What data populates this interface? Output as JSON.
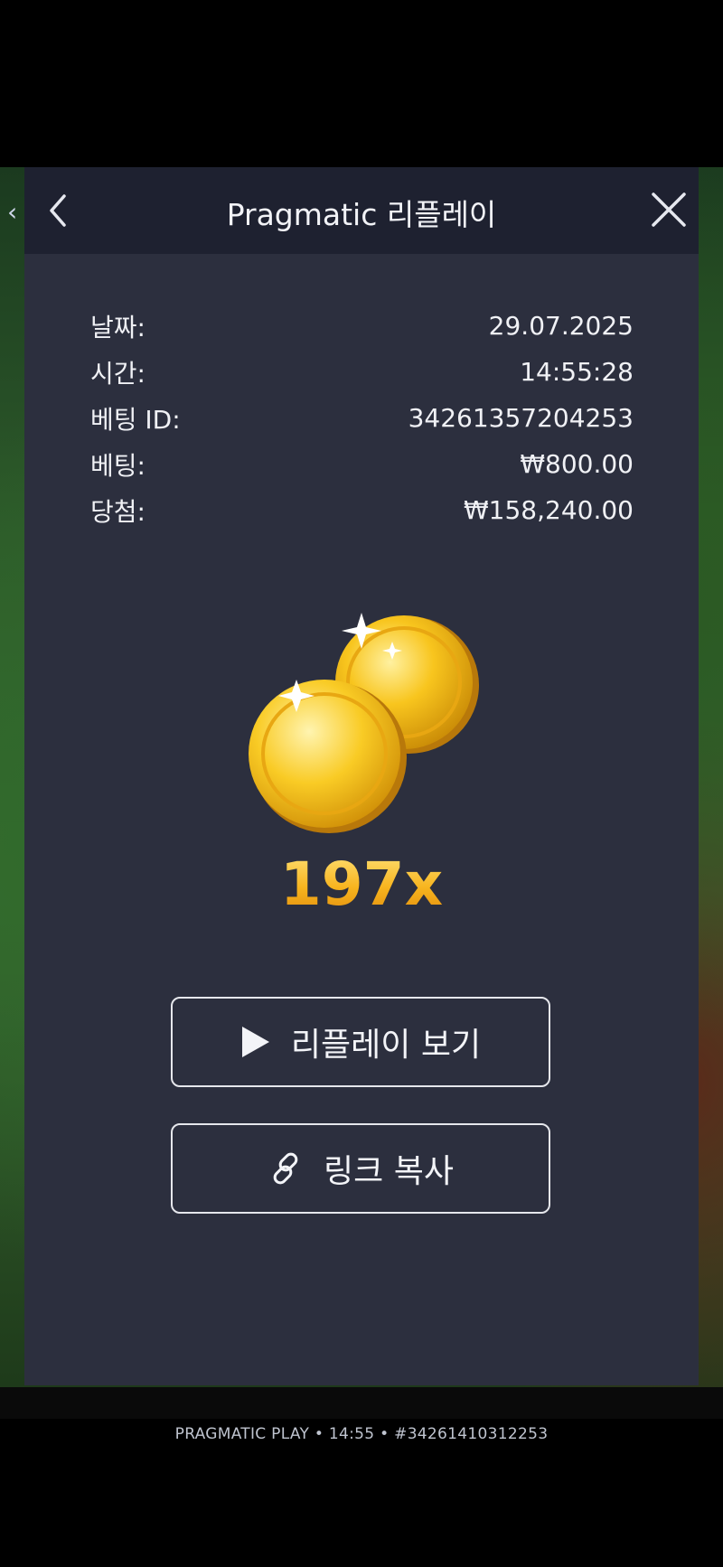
{
  "modal": {
    "title": "Pragmatic 리플레이",
    "back_icon": "chevron-left-icon",
    "close_icon": "close-icon"
  },
  "details": [
    {
      "label": "날짜:",
      "value": "29.07.2025"
    },
    {
      "label": "시간:",
      "value": "14:55:28"
    },
    {
      "label": "베팅 ID:",
      "value": "34261357204253"
    },
    {
      "label": "베팅:",
      "value": "₩800.00"
    },
    {
      "label": "당첨:",
      "value": "₩158,240.00"
    }
  ],
  "result": {
    "multiplier": "197x",
    "image": "gold-coins-icon"
  },
  "buttons": {
    "replay_label": "리플레이 보기",
    "replay_icon": "play-icon",
    "copy_label": "링크 복사",
    "copy_icon": "link-icon"
  },
  "footer": {
    "caption": "PRAGMATIC PLAY • 14:55 • #34261410312253"
  },
  "colors": {
    "modal_bg": "#2c2f3e",
    "header_bg": "#1e2130",
    "multiplier_gold": "#f5b21b"
  }
}
